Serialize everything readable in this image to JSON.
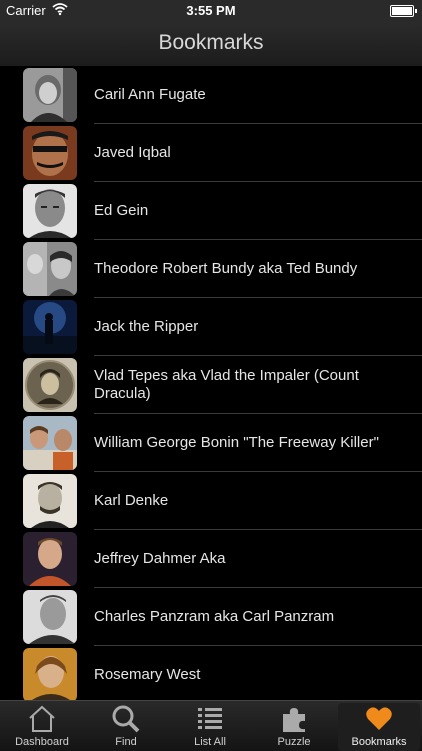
{
  "status_bar": {
    "carrier": "Carrier",
    "time": "3:55 PM"
  },
  "nav": {
    "title": "Bookmarks"
  },
  "bookmarks": [
    {
      "name": "Caril Ann Fugate"
    },
    {
      "name": "Javed Iqbal"
    },
    {
      "name": "Ed Gein"
    },
    {
      "name": "Theodore Robert Bundy aka Ted Bundy"
    },
    {
      "name": "Jack the Ripper"
    },
    {
      "name": "Vlad Tepes aka Vlad the Impaler (Count Dracula)"
    },
    {
      "name": "William George Bonin \"The Freeway Killer\""
    },
    {
      "name": "Karl Denke"
    },
    {
      "name": "Jeffrey Dahmer Aka"
    },
    {
      "name": "Charles Panzram aka Carl Panzram"
    },
    {
      "name": "Rosemary West"
    }
  ],
  "tabs": [
    {
      "label": "Dashboard",
      "icon": "home-icon"
    },
    {
      "label": "Find",
      "icon": "search-icon"
    },
    {
      "label": "List All",
      "icon": "list-icon"
    },
    {
      "label": "Puzzle",
      "icon": "puzzle-icon"
    },
    {
      "label": "Bookmarks",
      "icon": "heart-icon",
      "active": true
    }
  ],
  "colors": {
    "accent": "#f08a1a",
    "background": "#000000",
    "nav_bar": "#222222"
  }
}
